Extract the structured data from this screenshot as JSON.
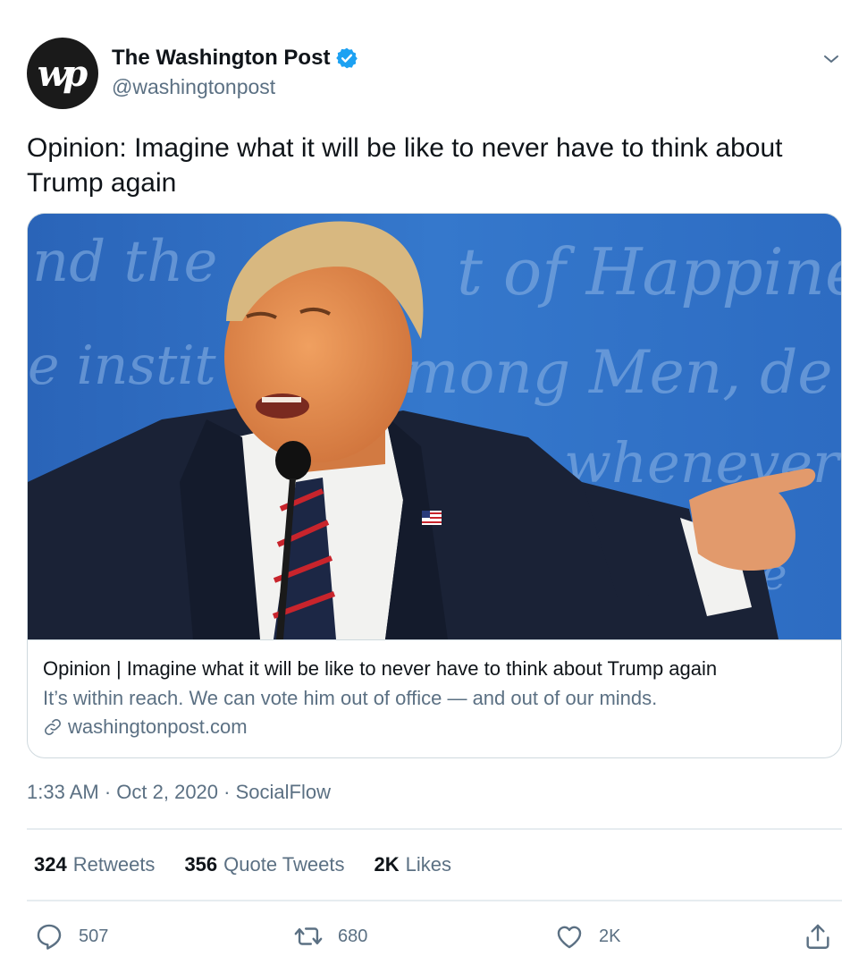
{
  "account": {
    "avatar_text": "wp",
    "display_name": "The Washington Post",
    "handle": "@washingtonpost",
    "verified": true,
    "verified_color": "#1da1f2"
  },
  "tweet": {
    "text": "Opinion: Imagine what it will be like to never have to think about Trump again"
  },
  "card": {
    "image_alt": "Photo of Donald Trump speaking at a debate podium, pointing",
    "title": "Opinion | Imagine what it will be like to never have to think about Trump again",
    "description": "It’s within reach. We can vote him out of office — and out of our minds.",
    "domain": "washingtonpost.com"
  },
  "meta": {
    "time": "1:33 AM",
    "separator": " · ",
    "date": "Oct 2, 2020",
    "source": "SocialFlow"
  },
  "stats": {
    "retweets_count": "324",
    "retweets_label": "Retweets",
    "quotes_count": "356",
    "quotes_label": "Quote Tweets",
    "likes_count": "2K",
    "likes_label": "Likes"
  },
  "actions": {
    "reply_count": "507",
    "retweet_count": "680",
    "like_count": "2K"
  },
  "icons": {
    "caret": "chevron-down-icon",
    "verified": "verified-badge-icon",
    "link": "link-icon",
    "reply": "reply-icon",
    "retweet": "retweet-icon",
    "like": "heart-icon",
    "share": "share-icon"
  },
  "colors": {
    "text_primary": "#0f1419",
    "text_secondary": "#5b7083",
    "border": "#cfd9de",
    "accent": "#1da1f2"
  }
}
